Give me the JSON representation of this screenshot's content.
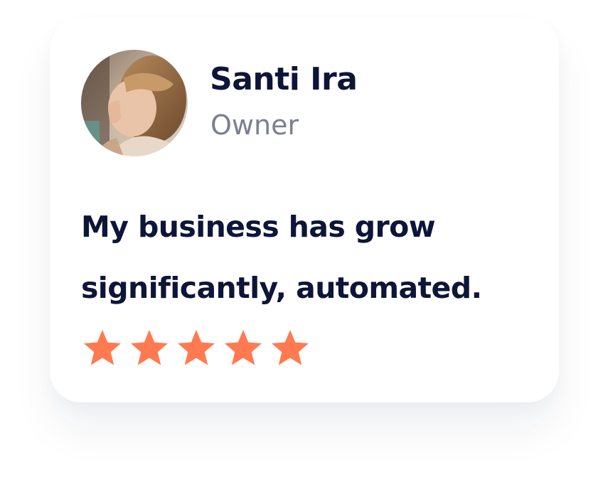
{
  "testimonial": {
    "name": "Santi Ira",
    "role": "Owner",
    "quote_lines": [
      "My business has grow",
      "significantly, automated."
    ],
    "rating": {
      "value": 5,
      "max": 5
    },
    "avatar_icon": "portrait-photo"
  },
  "colors": {
    "card_background": "#ffffff",
    "name_text": "#0d1538",
    "role_text": "#7c7f92",
    "quote_text": "#0d1538",
    "star": "#ff7a50"
  }
}
